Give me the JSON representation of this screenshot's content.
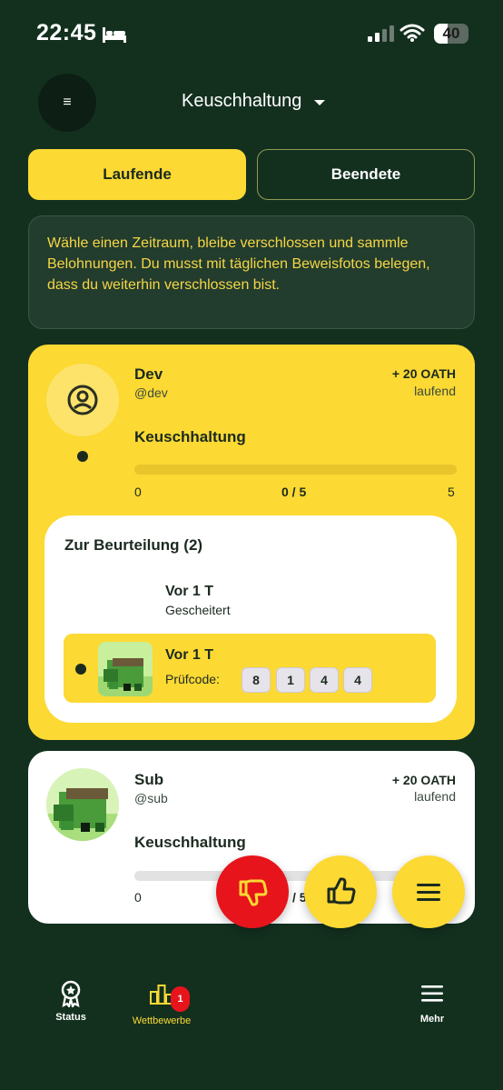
{
  "status_bar": {
    "time": "22:45",
    "battery": "40",
    "battery_level": 0.4
  },
  "header": {
    "title": "Keuschhaltung",
    "menu_glyph": "≡"
  },
  "tabs": [
    {
      "label": "Laufende",
      "active": true
    },
    {
      "label": "Beendete",
      "active": false
    }
  ],
  "info_text": "Wähle einen Zeitraum, bleibe verschlossen und sammle Belohnungen. Du musst mit täglichen Beweisfotos belegen, dass du weiterhin verschlossen bist.",
  "cards": [
    {
      "name": "Dev",
      "handle": "@dev",
      "reward": "+ 20 OATH",
      "state": "laufend",
      "goal": "Keuschhaltung",
      "progress_min": "0",
      "progress_value": "0 / 5",
      "progress_max": "5",
      "progress_fraction": 0
    },
    {
      "name": "Sub",
      "handle": "@sub",
      "reward": "+ 20 OATH",
      "state": "laufend",
      "goal": "Keuschhaltung",
      "progress_min": "0",
      "progress_value": "/ 5",
      "progress_max": "5",
      "progress_fraction": 0
    }
  ],
  "review": {
    "title": "Zur Beurteilung (2)",
    "entries": [
      {
        "time": "Vor 1 T",
        "status": "Gescheitert"
      },
      {
        "time": "Vor 1 T",
        "code_label": "Prüfcode:",
        "code": [
          "8",
          "1",
          "4",
          "4"
        ]
      }
    ]
  },
  "nav": {
    "items": [
      {
        "label": "Status",
        "icon": "award-icon"
      },
      {
        "label": "Wettbewerbe",
        "icon": "podium-icon",
        "badge": "1"
      },
      {
        "label": "Mehr",
        "icon": "hamburger-icon"
      }
    ]
  },
  "colors": {
    "background": "#13301f",
    "accent": "#fcd933",
    "danger": "#e7141b",
    "info_text": "#f5d645"
  }
}
